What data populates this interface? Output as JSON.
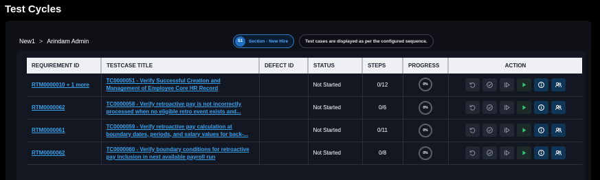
{
  "page": {
    "title": "Test Cycles"
  },
  "breadcrumb": {
    "cycle": "New1",
    "separator": ">",
    "user": "Arindam Admin"
  },
  "section": {
    "badge": "S1",
    "label": "Section - New Hire"
  },
  "info_note": "Test cases are displayed as per the configured sequence.",
  "table": {
    "headers": {
      "requirement_id": "REQUIREMENT ID",
      "testcase_title": "TESTCASE TITLE",
      "defect_id": "DEFECT ID",
      "status": "STATUS",
      "steps": "STEPS",
      "progress": "PROGRESS",
      "action": "ACTION"
    },
    "rows": [
      {
        "requirement_id": "RTM0000010 + 1 more",
        "testcase_title": "TC0000051 - Verify Successful Creation and Management of Employee Core HR Record",
        "defect_id": "",
        "status": "Not Started",
        "steps": "0/12",
        "progress": "0%"
      },
      {
        "requirement_id": "RTM0000062",
        "testcase_title": "TC0000058 - Verify retroactive pay is not incorrectly processed when no eligible retro event exists and...",
        "defect_id": "",
        "status": "Not Started",
        "steps": "0/6",
        "progress": "0%"
      },
      {
        "requirement_id": "RTM0000061",
        "testcase_title": "TC0000059 - Verify retroactive pay calculation at boundary dates, periods, and salary values for back-...",
        "defect_id": "",
        "status": "Not Started",
        "steps": "0/11",
        "progress": "0%"
      },
      {
        "requirement_id": "RTM0000062",
        "testcase_title": "TC0000060 - Verify boundary conditions for retroactive pay inclusion in next available payroll run",
        "defect_id": "",
        "status": "Not Started",
        "steps": "0/8",
        "progress": "0%"
      }
    ],
    "action_icons": [
      "reset-icon",
      "check-circle-icon",
      "step-play-icon",
      "play-icon",
      "info-icon",
      "users-icon"
    ]
  },
  "colors": {
    "background": "#000000",
    "link": "#38a3f0",
    "accent": "#1f6fc2",
    "play": "#2ecc71",
    "header_bg": "#eef0f4"
  }
}
